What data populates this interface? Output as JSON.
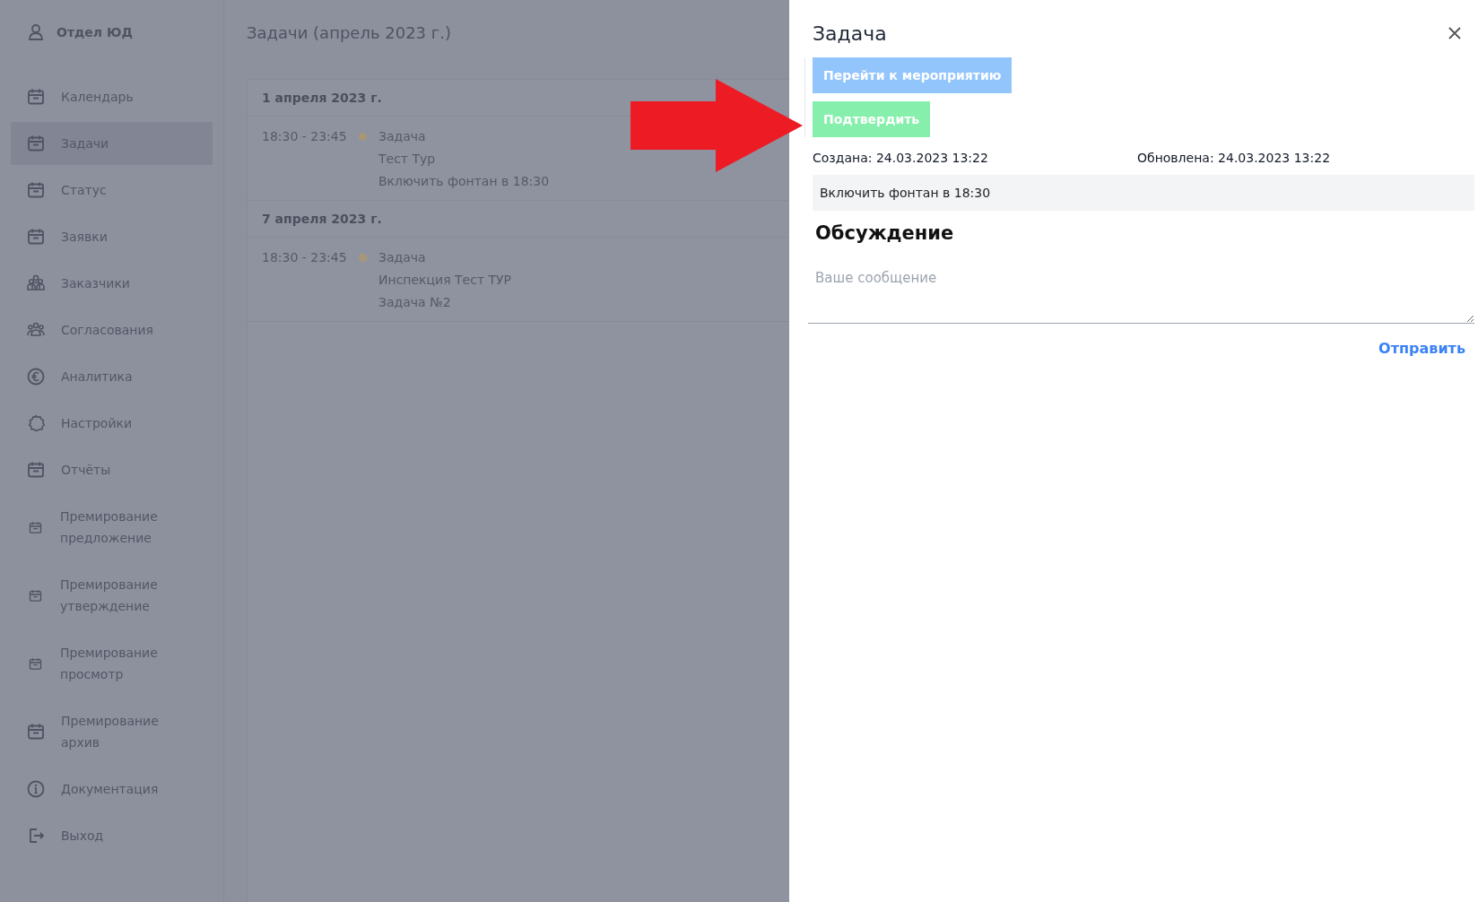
{
  "sidebar": {
    "user": "Отдел ЮД",
    "items": [
      {
        "label": "Календарь",
        "kind": "calendar",
        "selected": false
      },
      {
        "label": "Задачи",
        "kind": "calendar",
        "selected": true
      },
      {
        "label": "Статус",
        "kind": "calendar",
        "selected": false
      },
      {
        "label": "Заявки",
        "kind": "calendar",
        "selected": false
      },
      {
        "label": "Заказчики",
        "kind": "team",
        "selected": false
      },
      {
        "label": "Согласования",
        "kind": "group",
        "selected": false
      },
      {
        "label": "Аналитика",
        "kind": "euro",
        "selected": false
      },
      {
        "label": "Настройки",
        "kind": "gear",
        "selected": false
      },
      {
        "label": "Отчёты",
        "kind": "calendar",
        "selected": false
      },
      {
        "label": "Премирование предложение",
        "kind": "calendar-small",
        "selected": false
      },
      {
        "label": "Премирование утверждение",
        "kind": "calendar-small",
        "selected": false
      },
      {
        "label": "Премирование просмотр",
        "kind": "calendar-small",
        "selected": false
      },
      {
        "label": "Премирование архив",
        "kind": "calendar",
        "selected": false
      },
      {
        "label": "Документация",
        "kind": "info",
        "selected": false
      },
      {
        "label": "Выход",
        "kind": "logout",
        "selected": false
      }
    ]
  },
  "main": {
    "title": "Задачи (апрель 2023 г.)",
    "days": [
      {
        "date": "1 апреля 2023 г.",
        "events": [
          {
            "time": "18:30 - 23:45",
            "lines": [
              "Задача",
              "Тест Тур",
              "Включить фонтан в 18:30"
            ]
          }
        ]
      },
      {
        "date": "7 апреля 2023 г.",
        "events": [
          {
            "time": "18:30 - 23:45",
            "lines": [
              "Задача",
              "Инспекция Тест ТУР",
              "Задача №2"
            ]
          }
        ]
      }
    ]
  },
  "panel": {
    "title": "Задача",
    "buttons": [
      {
        "label": "Перейти к мероприятию",
        "kind": "primary"
      },
      {
        "label": "Подтвердить",
        "kind": "success"
      }
    ],
    "created": "Создана: 24.03.2023 13:22",
    "updated": "Обновлена: 24.03.2023 13:22",
    "description": "Включить фонтан в 18:30",
    "discussion": {
      "title": "Обсуждение",
      "placeholder": "Ваше сообщение",
      "send": "Отправить"
    }
  }
}
